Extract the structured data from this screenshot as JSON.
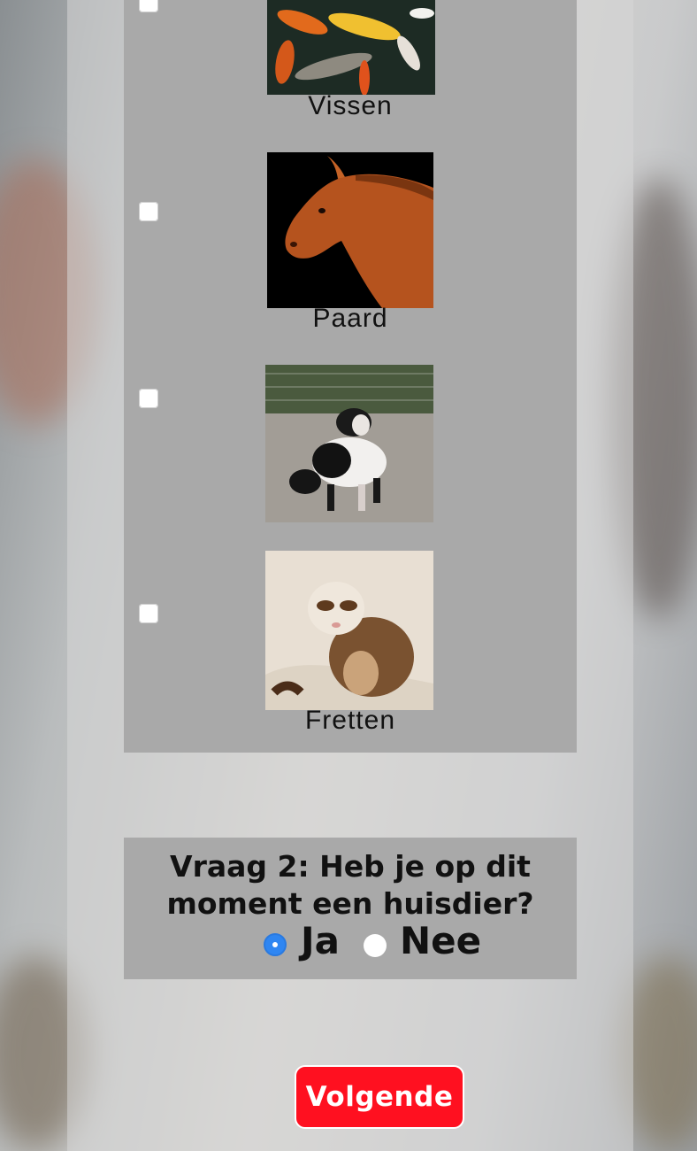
{
  "question1": {
    "options": [
      {
        "label": "Vissen",
        "image_icon": "koi-fish-photo",
        "checked": false
      },
      {
        "label": "Paard",
        "image_icon": "horse-photo",
        "checked": false
      },
      {
        "label": "",
        "image_icon": "pig-photo",
        "checked": false
      },
      {
        "label": "Fretten",
        "image_icon": "ferret-photo",
        "checked": false
      }
    ]
  },
  "question2": {
    "title": "Vraag 2: Heb je op dit moment een huisdier?",
    "options": [
      {
        "label": "Ja",
        "selected": true
      },
      {
        "label": "Nee",
        "selected": false
      }
    ]
  },
  "next_button": {
    "label": "Volgende"
  },
  "colors": {
    "panel": "#a9a9a9",
    "accent": "#ff1020",
    "radio_selected": "#2f86f2"
  }
}
